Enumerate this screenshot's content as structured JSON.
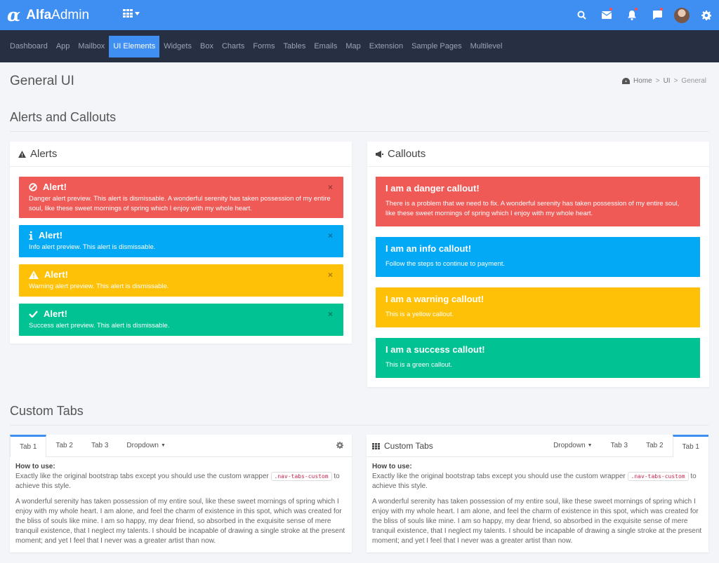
{
  "header": {
    "logo_glyph": "α",
    "brand_bold": "Alfa",
    "brand_light": "Admin",
    "icons": [
      "apps-grid-icon",
      "search-icon",
      "mail-icon",
      "bell-icon",
      "chat-icon",
      "avatar",
      "gear-icon"
    ]
  },
  "nav": {
    "items": [
      "Dashboard",
      "App",
      "Mailbox",
      "UI Elements",
      "Widgets",
      "Box",
      "Charts",
      "Forms",
      "Tables",
      "Emails",
      "Map",
      "Extension",
      "Sample Pages",
      "Multilevel"
    ],
    "active": "UI Elements"
  },
  "page": {
    "title": "General UI",
    "breadcrumb": [
      "Home",
      "UI",
      "General"
    ]
  },
  "sections": {
    "alerts_callouts": "Alerts and Callouts",
    "custom_tabs": "Custom Tabs"
  },
  "alerts": {
    "title": "Alerts",
    "items": [
      {
        "title": "Alert!",
        "text": "Danger alert preview. This alert is dismissable. A wonderful serenity has taken possession of my entire soul, like these sweet mornings of spring which I enjoy with my whole heart.",
        "color": "#f05a56",
        "icon": "ban-icon"
      },
      {
        "title": "Alert!",
        "text": "Info alert preview. This alert is dismissable.",
        "color": "#03a9f4",
        "icon": "info-icon"
      },
      {
        "title": "Alert!",
        "text": "Warning alert preview. This alert is dismissable.",
        "color": "#ffc108",
        "icon": "warning-icon"
      },
      {
        "title": "Alert!",
        "text": "Success alert preview. This alert is dismissable.",
        "color": "#00c292",
        "icon": "check-icon"
      }
    ],
    "close": "×"
  },
  "callouts": {
    "title": "Callouts",
    "items": [
      {
        "title": "I am a danger callout!",
        "text": "There is a problem that we need to fix. A wonderful serenity has taken possession of my entire soul, like these sweet mornings of spring which I enjoy with my whole heart.",
        "color": "#f05a56"
      },
      {
        "title": "I am an info callout!",
        "text": "Follow the steps to continue to payment.",
        "color": "#03a9f4"
      },
      {
        "title": "I am a warning callout!",
        "text": "This is a yellow callout.",
        "color": "#ffc108"
      },
      {
        "title": "I am a success callout!",
        "text": "This is a green callout.",
        "color": "#00c292"
      }
    ]
  },
  "tabs_left": {
    "tabs": [
      "Tab 1",
      "Tab 2",
      "Tab 3"
    ],
    "dropdown": "Dropdown",
    "active": "Tab 1"
  },
  "tabs_right": {
    "title": "Custom Tabs",
    "dropdown": "Dropdown",
    "tabs": [
      "Tab 3",
      "Tab 2",
      "Tab 1"
    ],
    "active": "Tab 1"
  },
  "tab_content": {
    "howto": "How to use:",
    "line1": "Exactly like the original bootstrap tabs except you should use the custom wrapper",
    "code": ".nav-tabs-custom",
    "line2": "to achieve this style.",
    "para": "A wonderful serenity has taken possession of my entire soul, like these sweet mornings of spring which I enjoy with my whole heart. I am alone, and feel the charm of existence in this spot, which was created for the bliss of souls like mine. I am so happy, my dear friend, so absorbed in the exquisite sense of mere tranquil existence, that I neglect my talents. I should be incapable of drawing a single stroke at the present moment; and yet I feel that I never was a greater artist than now."
  }
}
